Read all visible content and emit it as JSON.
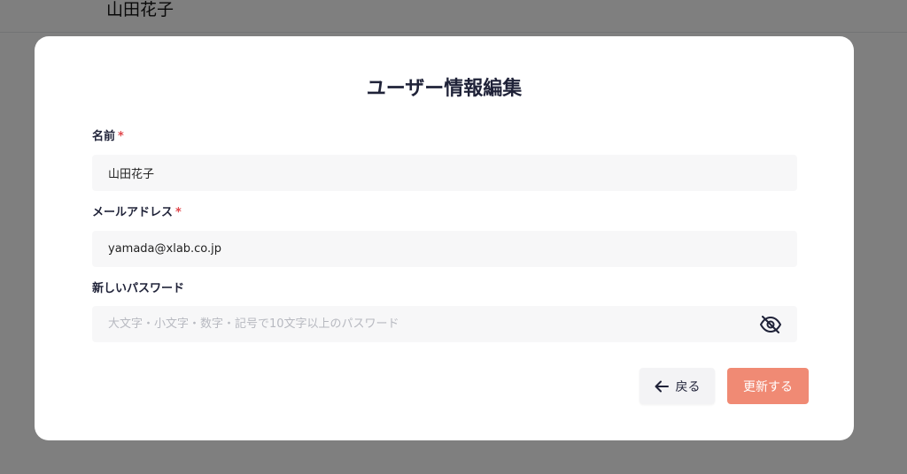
{
  "background": {
    "user_name": "山田花子"
  },
  "modal": {
    "title": "ユーザー情報編集",
    "fields": {
      "name": {
        "label": "名前",
        "required_mark": "*",
        "value": "山田花子"
      },
      "email": {
        "label": "メールアドレス",
        "required_mark": "*",
        "value": "yamada@xlab.co.jp"
      },
      "password": {
        "label": "新しいパスワード",
        "value": "",
        "placeholder": "大文字・小文字・数字・記号で10文字以上のパスワード",
        "toggle_icon": "eye-off-icon"
      }
    },
    "buttons": {
      "back_label": "戻る",
      "back_icon": "arrow-left-icon",
      "update_label": "更新する"
    }
  },
  "colors": {
    "primary_button": "#f08a74",
    "required_mark": "#e0474c",
    "title_text": "#1f2238"
  }
}
